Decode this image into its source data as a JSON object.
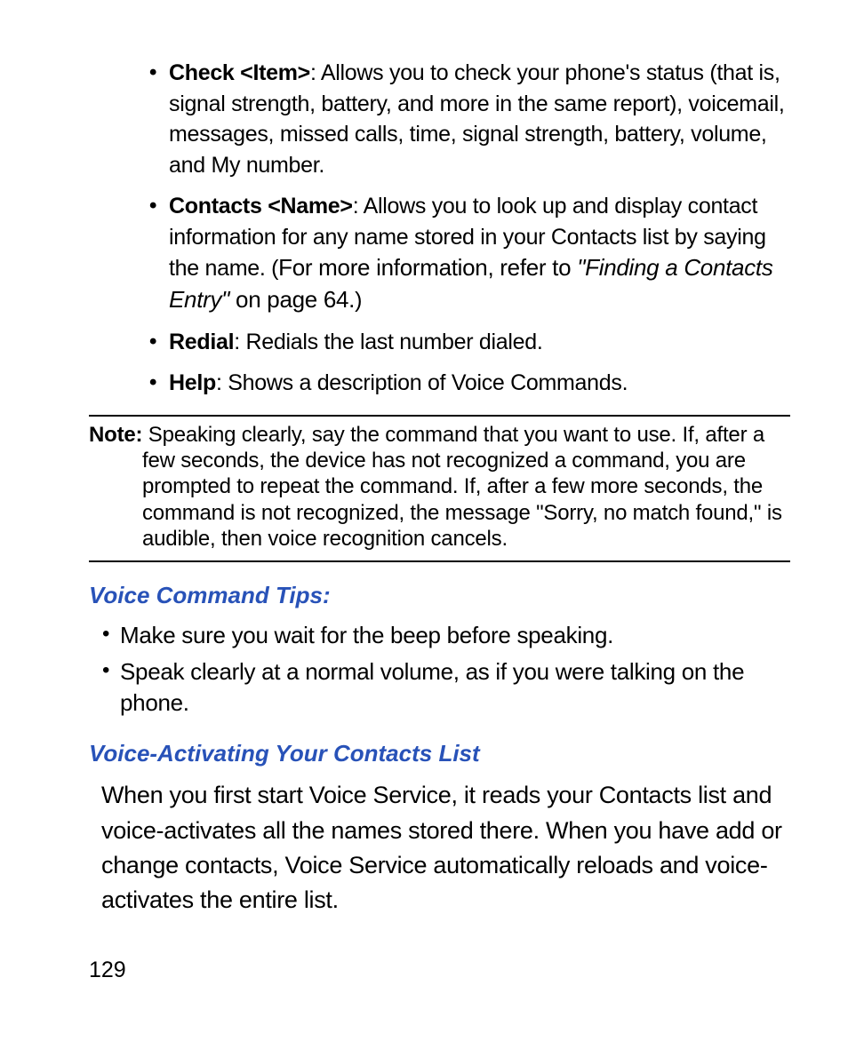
{
  "commands": {
    "check": {
      "name": "Check <Item>",
      "desc": ": Allows you to check your phone's status (that is, signal strength, battery, and more in the same report), voicemail, messages, missed calls, time, signal strength, battery, volume, and My number."
    },
    "contacts": {
      "name": "Contacts <Name>",
      "desc": ": Allows you to look up and display contact information for any name stored in your Contacts list by saying the name. (",
      "refer_prefix": "For more information, refer to ",
      "refer_title": "\"Finding a Contacts Entry\"",
      "refer_suffix": " on page 64.",
      "close": ")"
    },
    "redial": {
      "name": "Redial",
      "desc": ": Redials the last number dialed."
    },
    "help": {
      "name": "Help",
      "desc": ": Shows a description of Voice Commands."
    }
  },
  "note": {
    "label": "Note:",
    "text": " Speaking clearly, say the command that you want to use. If, after a few seconds, the device has not recognized a command, you are prompted to repeat the command. If, after a few more seconds, the command is not recognized, the message \"Sorry, no match found,\" is audible, then voice recognition cancels."
  },
  "tips": {
    "heading": "Voice Command Tips:",
    "items": [
      "Make sure you wait for the beep before speaking.",
      "Speak clearly at a normal volume, as if you were talking on the phone."
    ]
  },
  "voice_activating": {
    "heading": "Voice-Activating Your Contacts List",
    "body": "When you first start Voice Service, it reads your Contacts list and voice-activates all the names stored there. When you have add or change contacts, Voice Service automatically reloads and voice-activates the entire list."
  },
  "page_number": "129"
}
